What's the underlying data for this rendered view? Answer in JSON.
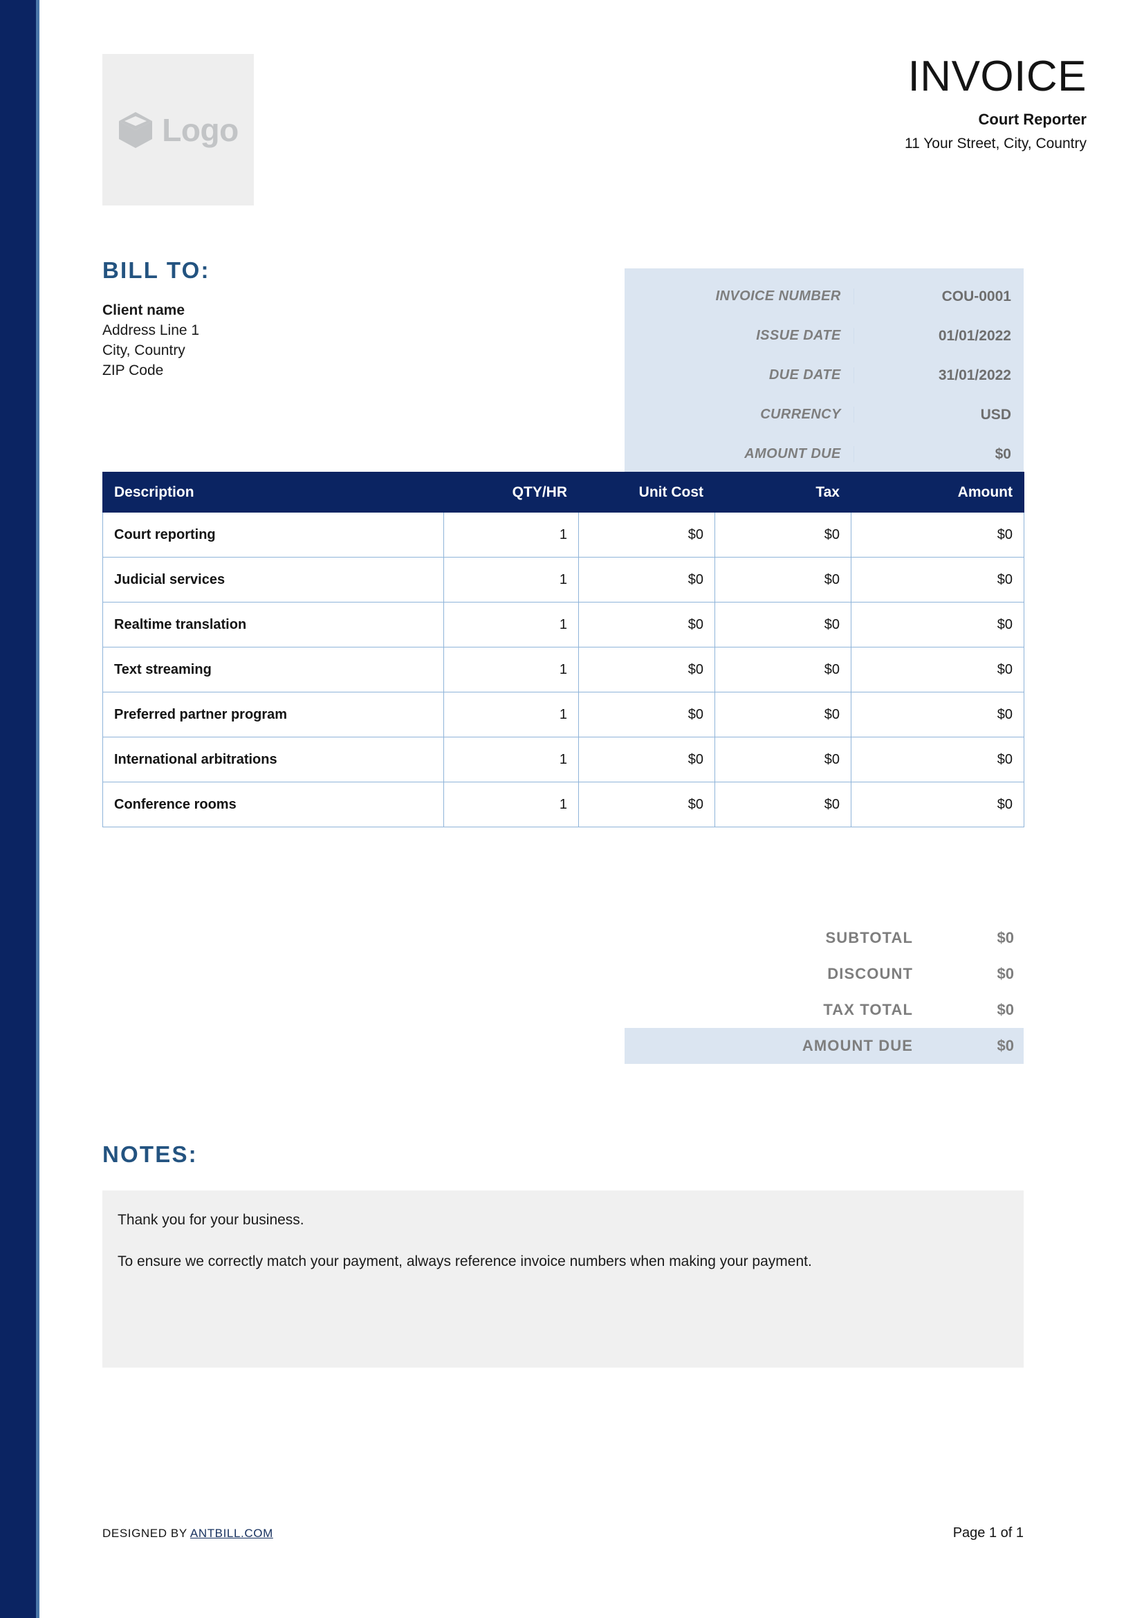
{
  "document": {
    "title": "INVOICE",
    "accent_navy": "#0b2462",
    "accent_steel_blue": "#235380",
    "meta_box_bg": "#dbe5f1",
    "notes_bg": "#f0f0f0"
  },
  "logo": {
    "icon": "cube-icon",
    "text": "Logo"
  },
  "header": {
    "title": "INVOICE",
    "company_name": "Court Reporter",
    "company_address": "11 Your Street, City, Country"
  },
  "bill_to": {
    "heading": "BILL TO:",
    "client_name": "Client name",
    "address_line_1": "Address Line 1",
    "city_country": "City, Country",
    "zip_code": "ZIP Code"
  },
  "invoice_meta": [
    {
      "label": "INVOICE NUMBER",
      "value": "COU-0001"
    },
    {
      "label": "ISSUE DATE",
      "value": "01/01/2022"
    },
    {
      "label": "DUE DATE",
      "value": "31/01/2022"
    },
    {
      "label": "CURRENCY",
      "value": "USD"
    },
    {
      "label": "AMOUNT DUE",
      "value": "$0"
    }
  ],
  "items_table": {
    "columns": [
      "Description",
      "QTY/HR",
      "Unit Cost",
      "Tax",
      "Amount"
    ],
    "rows": [
      {
        "description": "Court reporting",
        "qty": "1",
        "unit_cost": "$0",
        "tax": "$0",
        "amount": "$0"
      },
      {
        "description": "Judicial services",
        "qty": "1",
        "unit_cost": "$0",
        "tax": "$0",
        "amount": "$0"
      },
      {
        "description": "Realtime translation",
        "qty": "1",
        "unit_cost": "$0",
        "tax": "$0",
        "amount": "$0"
      },
      {
        "description": "Text streaming",
        "qty": "1",
        "unit_cost": "$0",
        "tax": "$0",
        "amount": "$0"
      },
      {
        "description": "Preferred partner program",
        "qty": "1",
        "unit_cost": "$0",
        "tax": "$0",
        "amount": "$0"
      },
      {
        "description": "International arbitrations",
        "qty": "1",
        "unit_cost": "$0",
        "tax": "$0",
        "amount": "$0"
      },
      {
        "description": "Conference rooms",
        "qty": "1",
        "unit_cost": "$0",
        "tax": "$0",
        "amount": "$0"
      }
    ]
  },
  "totals": [
    {
      "label": "SUBTOTAL",
      "value": "$0",
      "highlight": false
    },
    {
      "label": "DISCOUNT",
      "value": "$0",
      "highlight": false
    },
    {
      "label": "TAX TOTAL",
      "value": "$0",
      "highlight": false
    },
    {
      "label": "AMOUNT DUE",
      "value": "$0",
      "highlight": true
    }
  ],
  "notes": {
    "heading": "NOTES:",
    "paragraph_1": "Thank you for your business.",
    "paragraph_2": "To ensure we correctly match your payment, always reference invoice numbers when making your payment."
  },
  "footer": {
    "designed_by_prefix": "DESIGNED BY ",
    "designed_by_link": "ANTBILL.COM",
    "page_number": "Page 1 of 1"
  }
}
